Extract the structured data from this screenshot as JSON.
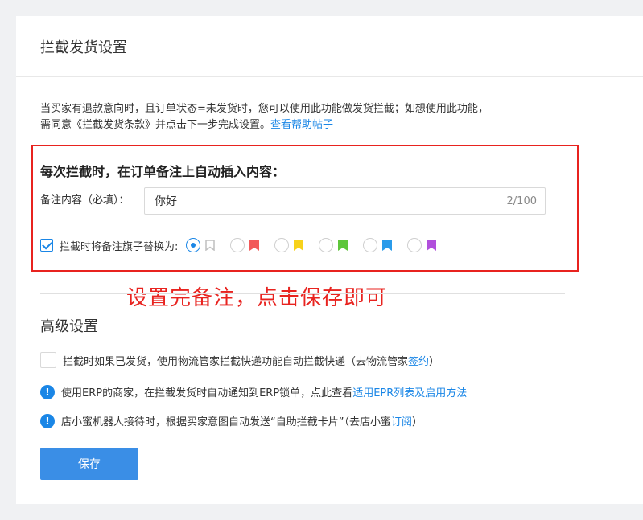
{
  "page": {
    "title": "拦截发货设置",
    "desc_line1": "当买家有退款意向时，且订单状态=未发货时，您可以使用此功能做发货拦截；如想使用此功能，",
    "desc_line2": "需同意《拦截发货条款》并点击下一步完成设置。",
    "help_link": "查看帮助帖子"
  },
  "rule": {
    "title": "每次拦截时，在订单备注上自动插入内容：",
    "remark_label": "备注内容（必填）：",
    "remark_value": "你好",
    "remark_count": "2/100",
    "flag_checkbox_checked": true,
    "flag_label": "拦截时将备注旗子替换为:",
    "flags": [
      {
        "icon": "flag-gray-icon",
        "color": "#bfbfbf",
        "selected": true
      },
      {
        "icon": "flag-red-icon",
        "color": "#f25a5a",
        "selected": false
      },
      {
        "icon": "flag-yellow-icon",
        "color": "#f7d21b",
        "selected": false
      },
      {
        "icon": "flag-green-icon",
        "color": "#5ec63b",
        "selected": false
      },
      {
        "icon": "flag-blue-icon",
        "color": "#2a9bea",
        "selected": false
      },
      {
        "icon": "flag-purple-icon",
        "color": "#b14fdc",
        "selected": false
      }
    ]
  },
  "annotation": "设置完备注，点击保存即可",
  "advanced": {
    "title": "高级设置",
    "row1_text": "拦截时如果已发货，使用物流管家拦截快递功能自动拦截快递（去物流管家",
    "row1_link": "签约",
    "row1_suffix": "）",
    "row2_text": "使用ERP的商家，在拦截发货时自动通知到ERP锁单，点此查看",
    "row2_link": "适用EPR列表及启用方法",
    "row3_text": "店小蜜机器人接待时，根据买家意图自动发送“自助拦截卡片”（去店小蜜",
    "row3_link": "订阅",
    "row3_suffix": "）",
    "info_glyph": "!"
  },
  "save_label": "保存",
  "colors": {
    "accent": "#1a86e6",
    "highlight_box": "#e8231f",
    "annotation": "#e8231f",
    "button": "#3a8ee6"
  }
}
